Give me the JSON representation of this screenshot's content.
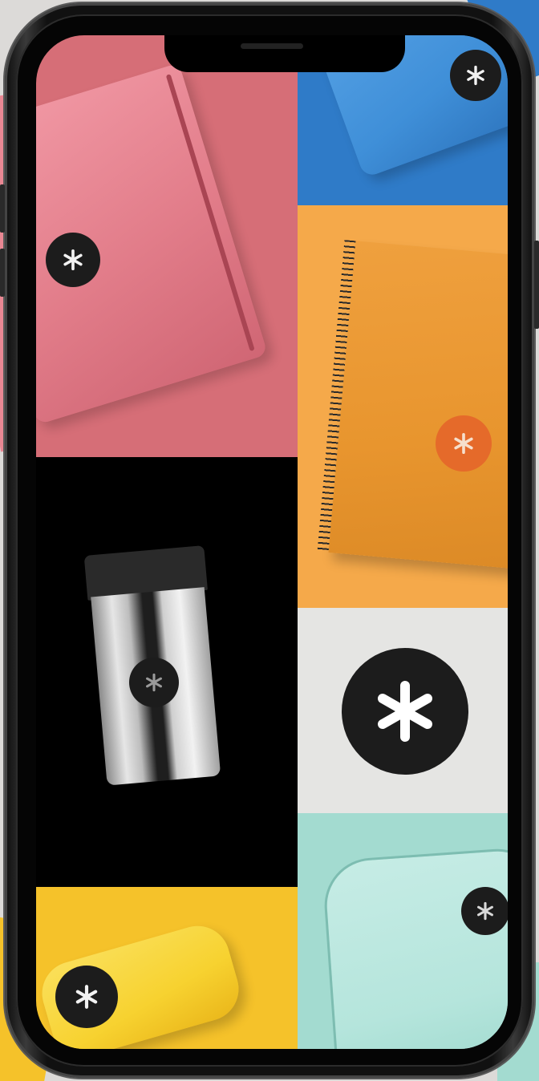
{
  "device": {
    "type": "smartphone",
    "frame_color": "#111111"
  },
  "grid_tiles": [
    {
      "id": "pink",
      "product": "pencil-case",
      "background": "#d66e77",
      "product_color": "#e98793",
      "icon": "asterisk-logo-icon"
    },
    {
      "id": "blue",
      "product": "pencil-case",
      "background": "#2f7bc8",
      "product_color": "#3f8fd8",
      "icon": "asterisk-logo-icon"
    },
    {
      "id": "orange",
      "product": "spiral-notebook",
      "background": "#f5a94a",
      "product_color": "#e9962f",
      "icon": "asterisk-logo-icon"
    },
    {
      "id": "black",
      "product": "thermal-tumbler",
      "background": "#000000",
      "product_color": "#c9c9c9",
      "icon": "asterisk-logo-icon"
    },
    {
      "id": "white",
      "product": "brand-logo",
      "background": "#e5e5e3",
      "product_color": "#1c1c1c",
      "icon": "asterisk-logo-icon"
    },
    {
      "id": "yellow",
      "product": "pencil-case",
      "background": "#f5c22a",
      "product_color": "#f7d230",
      "icon": "asterisk-logo-icon"
    },
    {
      "id": "teal",
      "product": "backpack",
      "background": "#a3dbd0",
      "product_color": "#b5e5dc",
      "icon": "asterisk-logo-icon"
    }
  ],
  "brand": {
    "logo_icon": "asterisk-logo-icon",
    "logo_color": "#1c1c1c",
    "logo_symbol_color": "#ffffff"
  }
}
